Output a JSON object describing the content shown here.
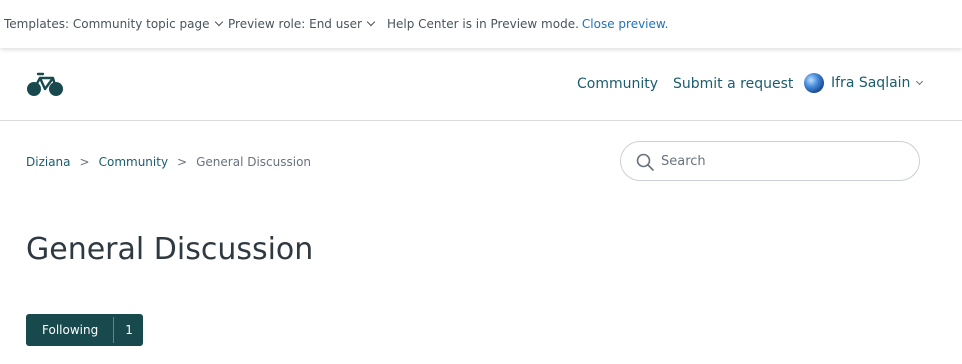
{
  "preview_bar": {
    "template_label": "Templates: Community topic page",
    "role_label": "Preview role: End user",
    "mode_text": "Help Center is in Preview mode.",
    "close_link": "Close preview."
  },
  "header": {
    "logo_icon": "bicycle-icon",
    "nav": {
      "community": "Community",
      "submit_request": "Submit a request"
    },
    "user": {
      "name": "Ifra Saqlain",
      "avatar_icon": "globe-avatar-icon"
    }
  },
  "breadcrumb": {
    "items": [
      "Diziana",
      "Community",
      "General Discussion"
    ],
    "separator": ">"
  },
  "search": {
    "placeholder": "Search",
    "value": ""
  },
  "page": {
    "title": "General Discussion"
  },
  "follow": {
    "label": "Following",
    "count": "1"
  },
  "colors": {
    "brand": "#17494d",
    "link": "#1b5c6e",
    "preview_link": "#1f73b7"
  }
}
